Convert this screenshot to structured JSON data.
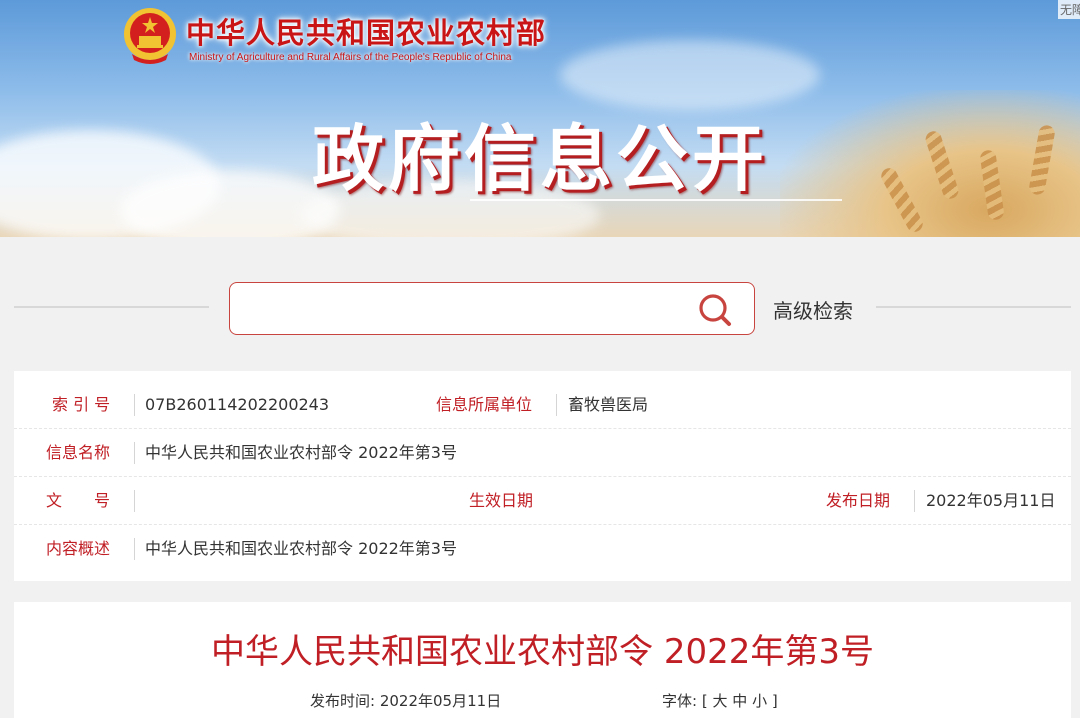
{
  "header": {
    "ministry_cn": "中华人民共和国农业农村部",
    "ministry_en": "Ministry of Agriculture and Rural Affairs of the People's Republic of China",
    "accessibility": "无障碍",
    "banner_title": "政府信息公开"
  },
  "search": {
    "placeholder": "",
    "value": "",
    "advanced_label": "高级检索",
    "icon": "search-icon"
  },
  "info": {
    "index_label": "索 引 号",
    "index_value": "07B260114202200243",
    "unit_label": "信息所属单位",
    "unit_value": "畜牧兽医局",
    "name_label": "信息名称",
    "name_value": "中华人民共和国农业农村部令 2022年第3号",
    "docno_label": "文　　号",
    "docno_value": "",
    "effective_label": "生效日期",
    "effective_value": "",
    "publish_label": "发布日期",
    "publish_value": "2022年05月11日",
    "summary_label": "内容概述",
    "summary_value": "中华人民共和国农业农村部令 2022年第3号"
  },
  "article": {
    "title": "中华人民共和国农业农村部令 2022年第3号",
    "publish_time_label": "发布时间:",
    "publish_time_value": "2022年05月11日",
    "font_label": "字体:",
    "font_open": "[",
    "font_large": "大",
    "font_medium": "中",
    "font_small": "小",
    "font_close": "]"
  },
  "colors": {
    "accent": "#c01f25",
    "emblem_red": "#d3201e",
    "emblem_gold": "#f1c232"
  }
}
